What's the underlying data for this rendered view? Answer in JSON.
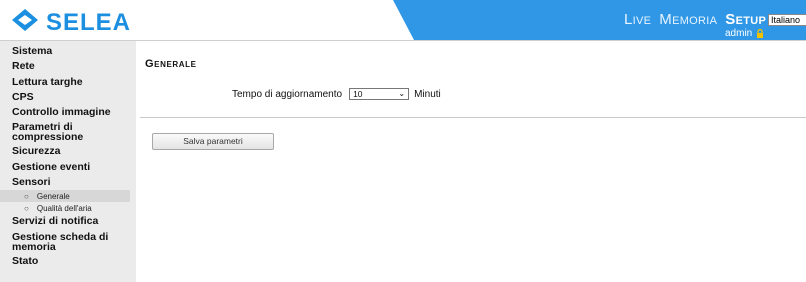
{
  "header": {
    "logo_text": "SELEA",
    "nav": [
      {
        "label": "Live"
      },
      {
        "label": "Memoria"
      },
      {
        "label": "Setup"
      }
    ],
    "language": "Italiano",
    "user": "admin",
    "colors": {
      "brand": "#1d8fe0",
      "banner": "#2f97e6"
    },
    "icons": [
      "selea-logo-icon",
      "lock-icon",
      "chevron-down-icon"
    ]
  },
  "sidebar": {
    "items": [
      {
        "label": "Sistema"
      },
      {
        "label": "Rete"
      },
      {
        "label": "Lettura targhe"
      },
      {
        "label": "CPS"
      },
      {
        "label": "Controllo immagine"
      },
      {
        "label": "Parametri di compressione"
      },
      {
        "label": "Sicurezza"
      },
      {
        "label": "Gestione eventi"
      },
      {
        "label": "Sensori"
      },
      {
        "label": "Servizi di notifica"
      },
      {
        "label": "Gestione scheda di memoria"
      },
      {
        "label": "Stato"
      }
    ],
    "sub_items": [
      {
        "label": "Generale",
        "active": true
      },
      {
        "label": "Qualità dell'aria",
        "active": false
      }
    ]
  },
  "main": {
    "title": "Generale",
    "update_label": "Tempo di aggiornamento",
    "update_value": "10",
    "update_unit": "Minuti",
    "save_label": "Salva parametri"
  }
}
